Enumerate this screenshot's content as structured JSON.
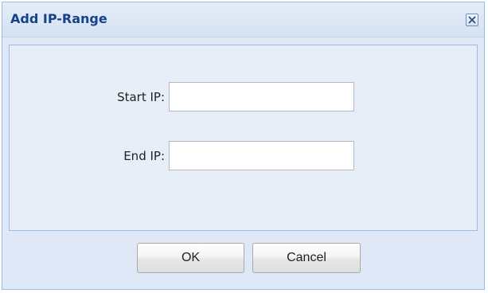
{
  "dialog": {
    "title": "Add IP-Range",
    "close_icon": "close-icon"
  },
  "form": {
    "start_ip": {
      "label": "Start IP:",
      "value": "",
      "placeholder": ""
    },
    "end_ip": {
      "label": "End IP:",
      "value": "",
      "placeholder": ""
    }
  },
  "buttons": {
    "ok_label": "OK",
    "cancel_label": "Cancel"
  },
  "colors": {
    "title_text": "#15428b",
    "dialog_background": "#dfe8f6",
    "border": "#99bbe8"
  }
}
